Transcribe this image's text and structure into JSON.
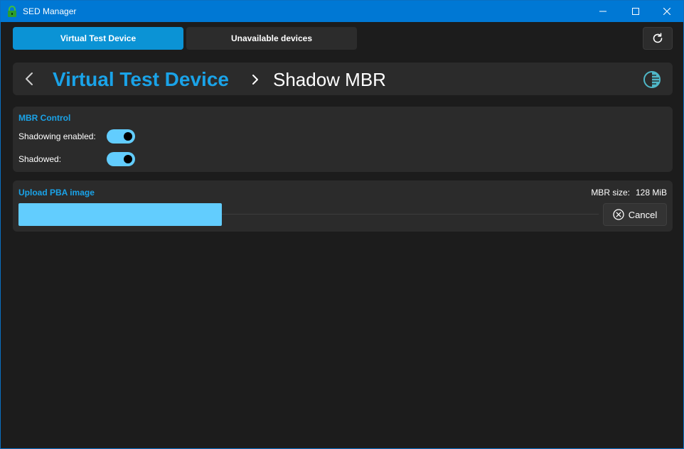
{
  "window": {
    "title": "SED Manager",
    "icon": "lock-icon",
    "controls": [
      "minimize-icon",
      "maximize-icon",
      "close-icon"
    ]
  },
  "tabs": [
    {
      "label": "Virtual Test Device",
      "active": true
    },
    {
      "label": "Unavailable devices",
      "active": false
    }
  ],
  "toolbar": {
    "refresh_icon": "refresh-icon"
  },
  "breadcrumb": {
    "back_icon": "chevron-left-icon",
    "device": "Virtual Test Device",
    "separator_icon": "chevron-right-icon",
    "page": "Shadow MBR",
    "theme_icon": "contrast-icon"
  },
  "mbr_control": {
    "heading": "MBR Control",
    "shadowing_enabled_label": "Shadowing enabled:",
    "shadowing_enabled": true,
    "shadowed_label": "Shadowed:",
    "shadowed": true
  },
  "upload": {
    "heading": "Upload PBA image",
    "mbr_size_label": "MBR size:",
    "mbr_size_value": "128 MiB",
    "progress_fraction": 0.35,
    "cancel_label": "Cancel",
    "cancel_icon": "cancel-circle-icon"
  },
  "colors": {
    "accent": "#1aa3e8",
    "toggle_on": "#62cdfe",
    "titlebar": "#0078d4",
    "background": "#1c1c1c",
    "card": "#2b2b2b"
  }
}
